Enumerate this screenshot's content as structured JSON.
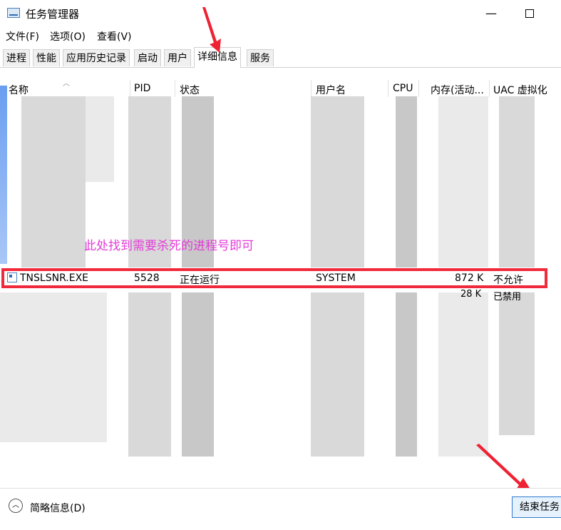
{
  "window": {
    "title": "任务管理器",
    "minimize_glyph": "—",
    "app_icon": "task-manager-icon"
  },
  "menu": [
    "文件(F)",
    "选项(O)",
    "查看(V)"
  ],
  "tabs": [
    {
      "label": "进程",
      "active": false
    },
    {
      "label": "性能",
      "active": false
    },
    {
      "label": "应用历史记录",
      "active": false
    },
    {
      "label": "启动",
      "active": false
    },
    {
      "label": "用户",
      "active": false
    },
    {
      "label": "详细信息",
      "active": true
    },
    {
      "label": "服务",
      "active": false
    }
  ],
  "columns": [
    "名称",
    "PID",
    "状态",
    "用户名",
    "CPU",
    "内存(活动...",
    "UAC 虚拟化"
  ],
  "annotation": "此处找到需要杀死的进程号即可",
  "highlighted_row": {
    "name": "TNSLSNR.EXE",
    "pid": "5528",
    "status": "正在运行",
    "user": "SYSTEM",
    "memory": "872 K",
    "uac": "不允许"
  },
  "partial_row": {
    "memory": "28 K",
    "uac": "已禁用"
  },
  "footer": {
    "fewer_details": "简略信息(D)",
    "end_task": "结束任务"
  },
  "colors": {
    "highlight_border": "#f0293b",
    "annotation": "#e43ad8",
    "arrow": "#ee2233",
    "button_border": "#2f78d0"
  }
}
